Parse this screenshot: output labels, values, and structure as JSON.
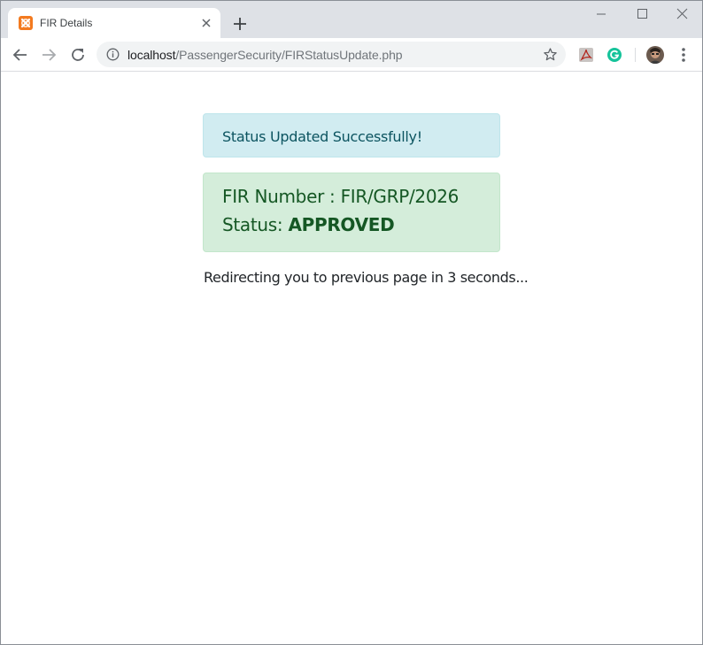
{
  "browser": {
    "tab": {
      "title": "FIR Details",
      "favicon": "xampp-icon"
    },
    "address_bar": {
      "host": "localhost",
      "path": "/PassengerSecurity/FIRStatusUpdate.php"
    },
    "extensions": [
      "acrobat-pdf-icon",
      "grammarly-icon"
    ]
  },
  "page": {
    "info_alert": "Status Updated Successfully!",
    "fir_label": "FIR Number : ",
    "fir_number": "FIR/GRP/2026",
    "status_label": "Status: ",
    "status_value": "APPROVED",
    "redirect_message": "Redirecting you to previous page in 3 seconds..."
  },
  "colors": {
    "info_bg": "#d1ecf1",
    "info_text": "#0c5460",
    "success_bg": "#d4edda",
    "success_text": "#155724"
  }
}
